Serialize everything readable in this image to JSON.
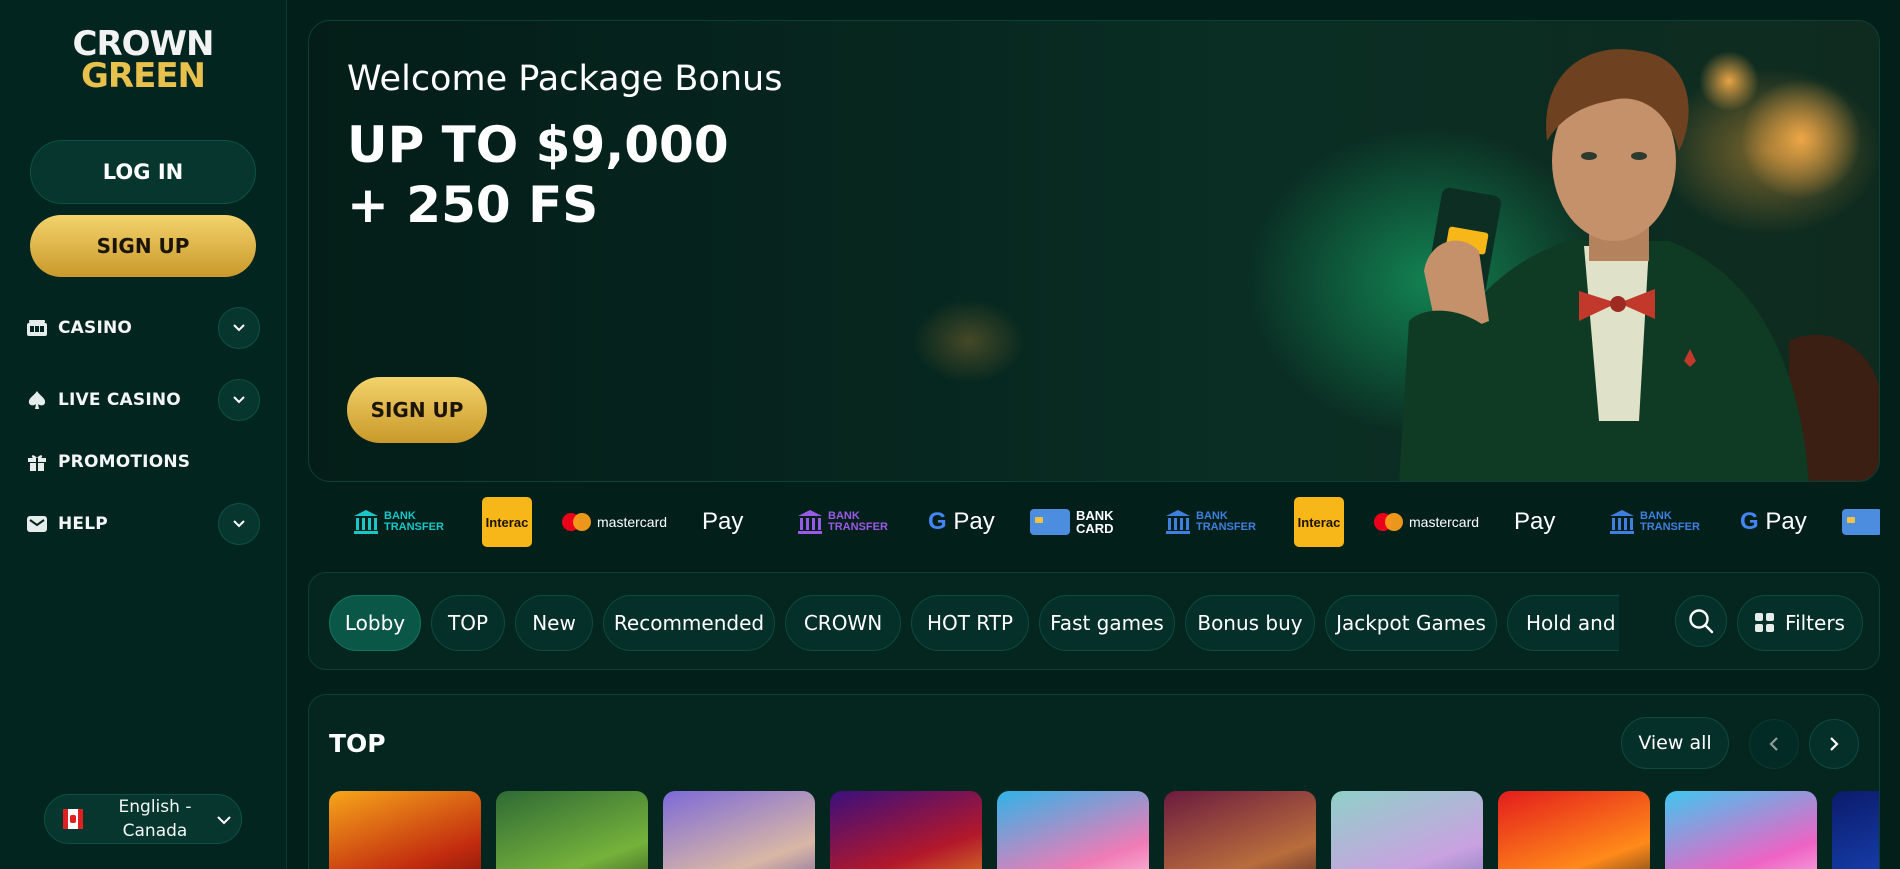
{
  "brand": {
    "line1": "CROWN",
    "line2": "GREEN"
  },
  "sidebar": {
    "login_label": "LOG IN",
    "signup_label": "SIGN UP",
    "items": [
      {
        "label": "CASINO",
        "icon": "casino-icon",
        "expandable": true
      },
      {
        "label": "LIVE CASINO",
        "icon": "spade-icon",
        "expandable": true
      },
      {
        "label": "PROMOTIONS",
        "icon": "gift-icon",
        "expandable": false
      },
      {
        "label": "HELP",
        "icon": "mail-icon",
        "expandable": true
      }
    ],
    "language": "English - Canada"
  },
  "hero": {
    "title": "Welcome Package Bonus",
    "line1": "UP TO $9,000",
    "line2": "+ 250 FS",
    "cta": "SIGN UP"
  },
  "payments": [
    {
      "type": "bank",
      "line1": "BANK",
      "line2": "TRANSFER",
      "color": "#19c7c7"
    },
    {
      "type": "interac",
      "label": "Interac"
    },
    {
      "type": "mastercard",
      "label": "mastercard"
    },
    {
      "type": "applepay",
      "label": "Pay"
    },
    {
      "type": "bank",
      "line1": "BANK",
      "line2": "TRANSFER",
      "color": "#9a5ae8"
    },
    {
      "type": "gpay",
      "label": "Pay"
    },
    {
      "type": "card",
      "line1": "BANK",
      "line2": "CARD"
    },
    {
      "type": "bank",
      "line1": "BANK",
      "line2": "TRANSFER",
      "color": "#3f7fe0"
    },
    {
      "type": "interac",
      "label": "Interac"
    },
    {
      "type": "mastercard",
      "label": "mastercard"
    },
    {
      "type": "applepay",
      "label": "Pay"
    },
    {
      "type": "bank",
      "line1": "BANK",
      "line2": "TRANSFER",
      "color": "#3f7fe0"
    },
    {
      "type": "gpay",
      "label": "Pay"
    },
    {
      "type": "card",
      "line1": "",
      "line2": ""
    }
  ],
  "categories": [
    "Lobby",
    "TOP",
    "New",
    "Recommended",
    "CROWN",
    "HOT RTP",
    "Fast games",
    "Bonus buy",
    "Jackpot Games",
    "Hold and"
  ],
  "filters_label": "Filters",
  "top_section": {
    "title": "TOP",
    "view_all": "View all"
  },
  "colors": {
    "background": "#031f1a",
    "gold": "#e8c04c",
    "chip": "#05302a",
    "chip_active": "#0a5748"
  }
}
